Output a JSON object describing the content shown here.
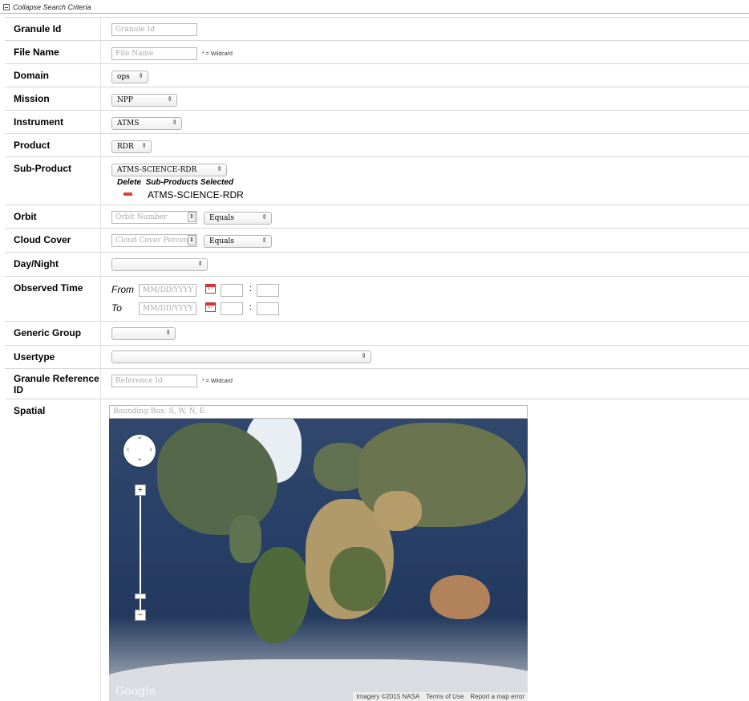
{
  "collapse_label": "Collapse Search Criteria",
  "fields": {
    "granule_id": {
      "label": "Granule Id",
      "placeholder": "Granule Id"
    },
    "file_name": {
      "label": "File Name",
      "placeholder": "File Name",
      "note": "* = Wildcard"
    },
    "domain": {
      "label": "Domain",
      "value": "ops"
    },
    "mission": {
      "label": "Mission",
      "value": "NPP"
    },
    "instrument": {
      "label": "Instrument",
      "value": "ATMS"
    },
    "product": {
      "label": "Product",
      "value": "RDR"
    },
    "sub_product": {
      "label": "Sub-Product",
      "value": "ATMS-SCIENCE-RDR",
      "delete_header": "Delete",
      "selected_header": "Sub-Products Selected",
      "selected": [
        "ATMS-SCIENCE-RDR"
      ]
    },
    "orbit": {
      "label": "Orbit",
      "placeholder": "Orbit Number",
      "operator": "Equals"
    },
    "cloud_cover": {
      "label": "Cloud Cover",
      "placeholder": "Cloud Cover Percent",
      "operator": "Equals"
    },
    "day_night": {
      "label": "Day/Night",
      "value": ""
    },
    "observed_time": {
      "label": "Observed Time",
      "from_label": "From",
      "to_label": "To",
      "date_placeholder": "MM/DD/YYYY",
      "calendar_day": "17",
      "separator": ":"
    },
    "generic_group": {
      "label": "Generic Group",
      "value": ""
    },
    "usertype": {
      "label": "Usertype",
      "value": ""
    },
    "granule_reference_id": {
      "label": "Granule Reference ID",
      "placeholder": "Reference Id",
      "note": "* = Wildcard"
    },
    "spatial": {
      "label": "Spatial",
      "placeholder": "Bounding Box: S, W, N, E"
    }
  },
  "map": {
    "logo": "Google",
    "attribution": [
      "Imagery ©2015 NASA",
      "Terms of Use",
      "Report a map error"
    ],
    "zoom_in": "+",
    "zoom_out": "−",
    "zoom_level": 0.09
  }
}
